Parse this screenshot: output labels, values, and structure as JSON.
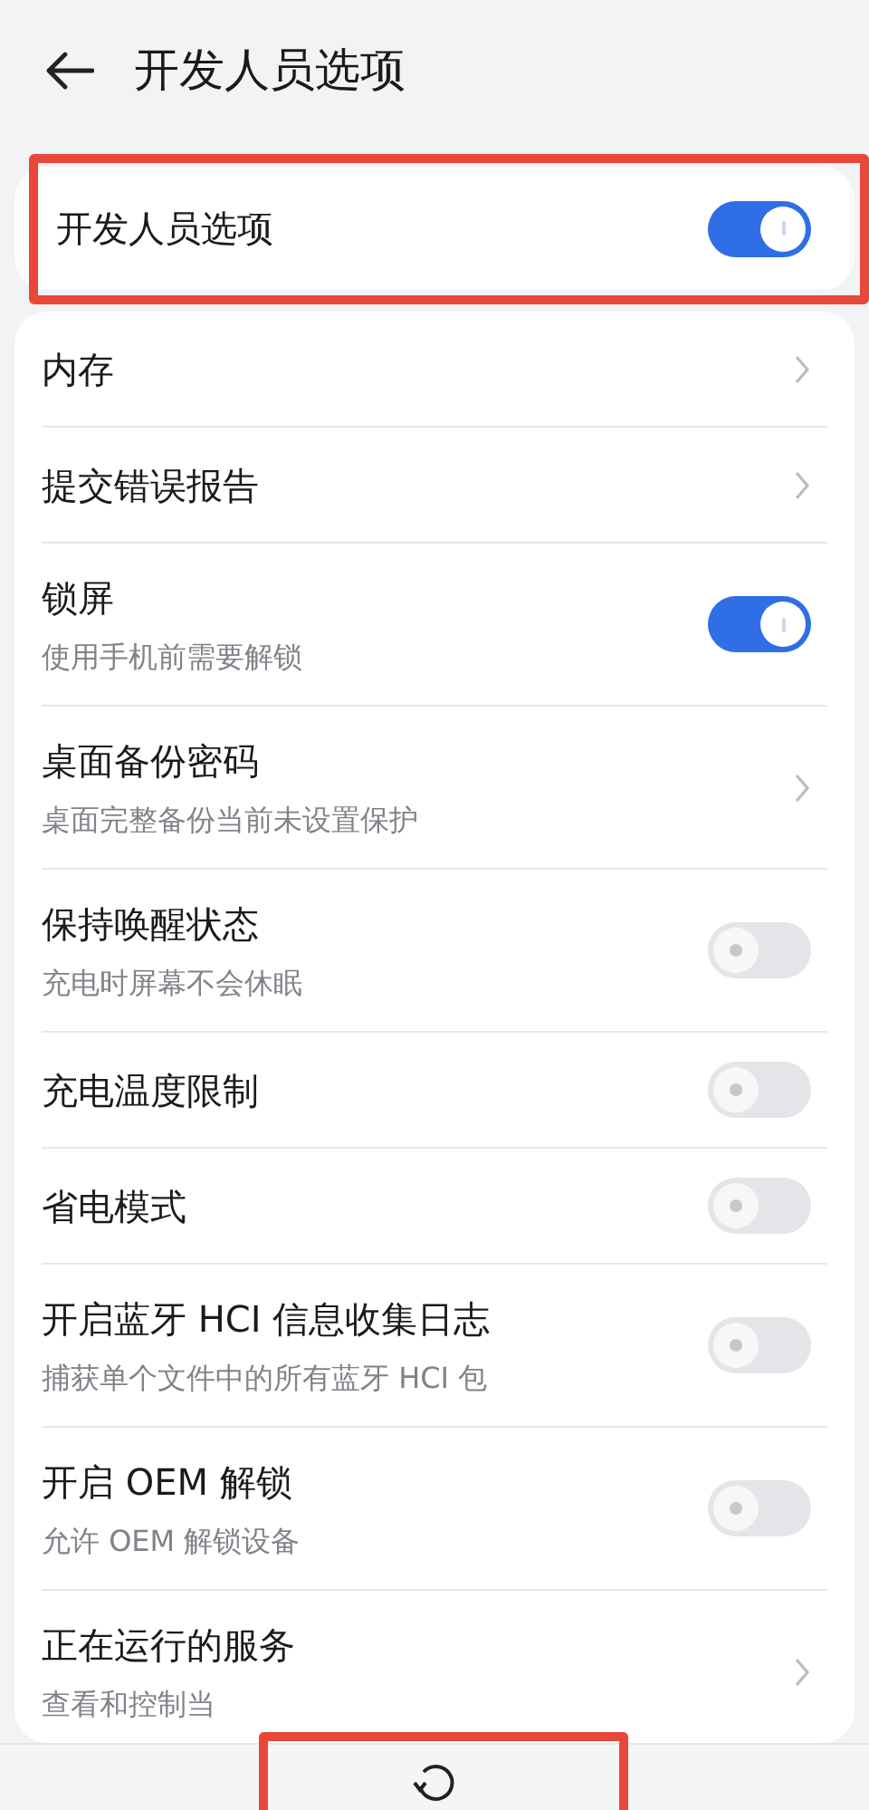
{
  "header": {
    "title": "开发人员选项"
  },
  "master": {
    "title": "开发人员选项",
    "on": true,
    "highlighted": true
  },
  "items": [
    {
      "kind": "link",
      "title": "内存"
    },
    {
      "kind": "link",
      "title": "提交错误报告"
    },
    {
      "kind": "toggle",
      "title": "锁屏",
      "subtitle": "使用手机前需要解锁",
      "on": true
    },
    {
      "kind": "link",
      "title": "桌面备份密码",
      "subtitle": "桌面完整备份当前未设置保护"
    },
    {
      "kind": "toggle",
      "title": "保持唤醒状态",
      "subtitle": "充电时屏幕不会休眠",
      "on": false
    },
    {
      "kind": "toggle",
      "title": "充电温度限制",
      "on": false
    },
    {
      "kind": "toggle",
      "title": "省电模式",
      "on": false
    },
    {
      "kind": "toggle",
      "title": "开启蓝牙 HCI 信息收集日志",
      "subtitle": "捕获单个文件中的所有蓝牙 HCI 包",
      "on": false
    },
    {
      "kind": "toggle",
      "title": "开启 OEM 解锁",
      "subtitle": "允许 OEM 解锁设备",
      "on": false
    },
    {
      "kind": "link",
      "title": "正在运行的服务",
      "subtitle": "查看和控制当"
    }
  ],
  "bottom_bar": {
    "rotate_highlighted": true
  }
}
